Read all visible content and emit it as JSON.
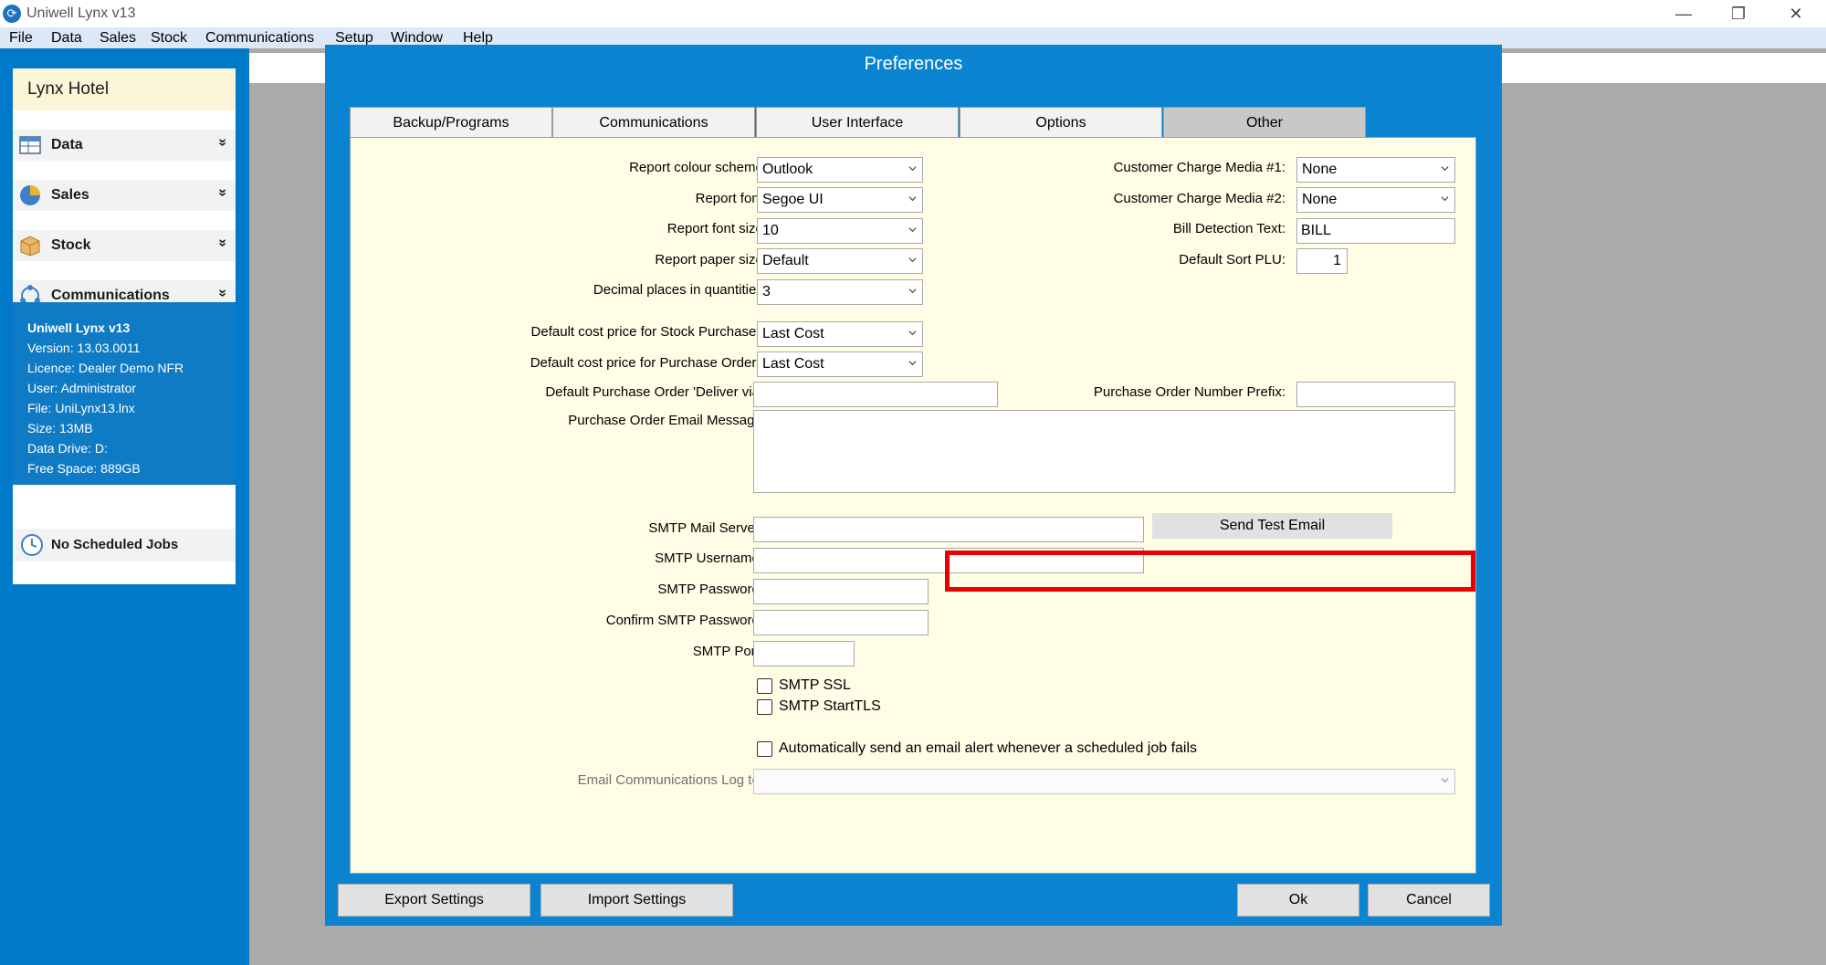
{
  "window": {
    "title": "Uniwell Lynx v13",
    "controls": [
      "—",
      "❐",
      "✕"
    ]
  },
  "menu": [
    "File",
    "Data",
    "Sales",
    "Stock",
    "Communications",
    "Setup",
    "Window",
    "Help"
  ],
  "sidebar": {
    "hotel": "Lynx Hotel",
    "sections": [
      {
        "label": "Data",
        "icon": "table-icon"
      },
      {
        "label": "Sales",
        "icon": "pie-chart-icon"
      },
      {
        "label": "Stock",
        "icon": "box-icon"
      },
      {
        "label": "Communications",
        "icon": "network-icon"
      }
    ],
    "chevron": "»",
    "info": [
      "Uniwell Lynx v13",
      "Version: 13.03.0011",
      "Licence: Dealer Demo NFR",
      "User: Administrator",
      "File: UniLynx13.lnx",
      "Size: 13MB",
      "Data Drive: D:",
      "Free Space: 889GB"
    ],
    "jobs": "No Scheduled Jobs"
  },
  "dialog": {
    "title": "Preferences",
    "tabs": [
      "Backup/Programs",
      "Communications",
      "User Interface",
      "Options",
      "Other"
    ],
    "active_tab": "Other",
    "left_combos": [
      {
        "label": "Report colour scheme:",
        "value": "Outlook"
      },
      {
        "label": "Report font:",
        "value": "Segoe UI"
      },
      {
        "label": "Report font size:",
        "value": "10"
      },
      {
        "label": "Report paper size:",
        "value": "Default"
      },
      {
        "label": "Decimal places in quantities:",
        "value": "3"
      },
      {
        "label": "Default cost price for Stock Purchases:",
        "value": "Last Cost"
      },
      {
        "label": "Default cost price for Purchase Orders:",
        "value": "Last Cost"
      }
    ],
    "right_fields": [
      {
        "label": "Customer Charge Media #1:",
        "value": "None"
      },
      {
        "label": "Customer Charge Media #2:",
        "value": "None"
      },
      {
        "label": "Bill Detection Text:",
        "value": "BILL"
      },
      {
        "label": "Default Sort PLU:",
        "value": "1"
      }
    ],
    "po_deliver_via": {
      "label": "Default Purchase Order 'Deliver via':",
      "value": ""
    },
    "po_number_prefix": {
      "label": "Purchase Order Number Prefix:",
      "value": ""
    },
    "po_email_message": {
      "label": "Purchase Order Email Message:",
      "value": ""
    },
    "smtp": {
      "server_label": "SMTP Mail Server:",
      "server_value": "",
      "test_button": "Send Test Email",
      "username_label": "SMTP Username:",
      "password_label": "SMTP Password:",
      "confirm_label": "Confirm SMTP Password:",
      "port_label": "SMTP Port:",
      "ssl_label": "SMTP SSL",
      "ssl_checked": false,
      "starttls_label": "SMTP StartTLS",
      "starttls_checked": false
    },
    "alert_label": "Automatically send an email alert whenever a scheduled job fails",
    "alert_checked": false,
    "log_label": "Email Communications Log to:",
    "log_value": "",
    "buttons": {
      "export": "Export Settings",
      "import": "Import Settings",
      "ok": "Ok",
      "cancel": "Cancel"
    }
  },
  "colors": {
    "sidebar": "#0079c9",
    "dialog_frame": "#0a84d0",
    "panel_bg": "#fffde5",
    "highlight": "#e60000"
  }
}
